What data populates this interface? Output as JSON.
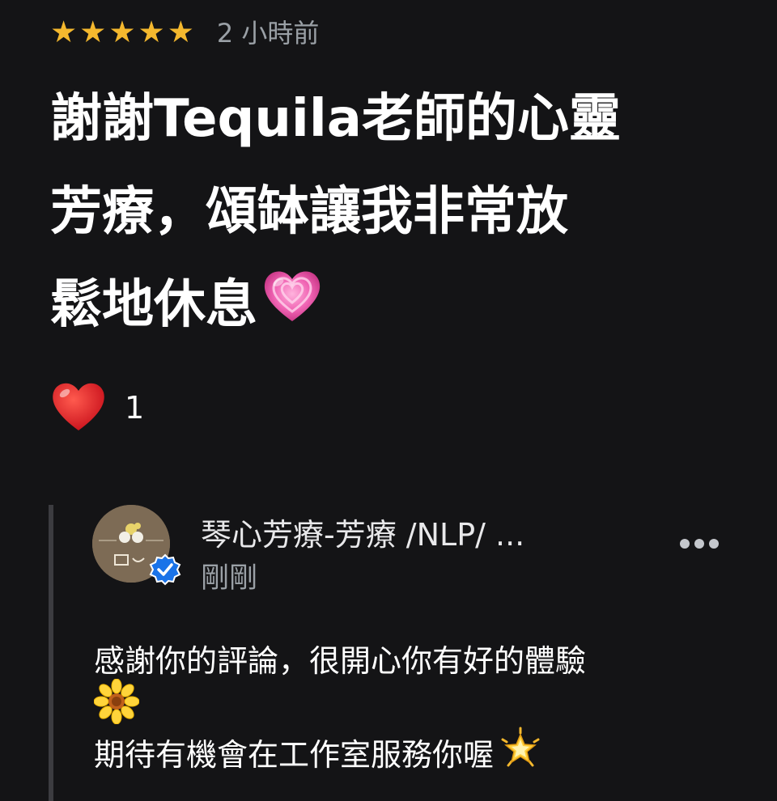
{
  "review": {
    "rating": 5,
    "stars": [
      "★",
      "★",
      "★",
      "★",
      "★"
    ],
    "time": "2 小時前",
    "text_lines": [
      "謝謝Tequila老師的心靈",
      "芳療，頌缽讓我非常放",
      "鬆地休息"
    ],
    "text_emoji": "growing-heart-icon"
  },
  "reaction": {
    "icon": "red-heart-icon",
    "count": "1"
  },
  "reply": {
    "owner_name": "琴心芳療-芳療 /NLP/ ...",
    "time": "剛剛",
    "avatar_icon": "qinxin-logo-avatar",
    "badge_icon": "verified-badge-icon",
    "lines": [
      "感謝你的評論，很開心你有好的體驗",
      "",
      "期待有機會在工作室服務你喔"
    ],
    "line2_emoji": "sunflower-icon",
    "line3_emoji": "glowing-star-icon"
  },
  "colors": {
    "background": "#141416",
    "star": "#f4b82e",
    "muted_text": "#9aa0a6",
    "reply_bar": "#3c3c40",
    "verified_badge": "#1a73e8"
  }
}
